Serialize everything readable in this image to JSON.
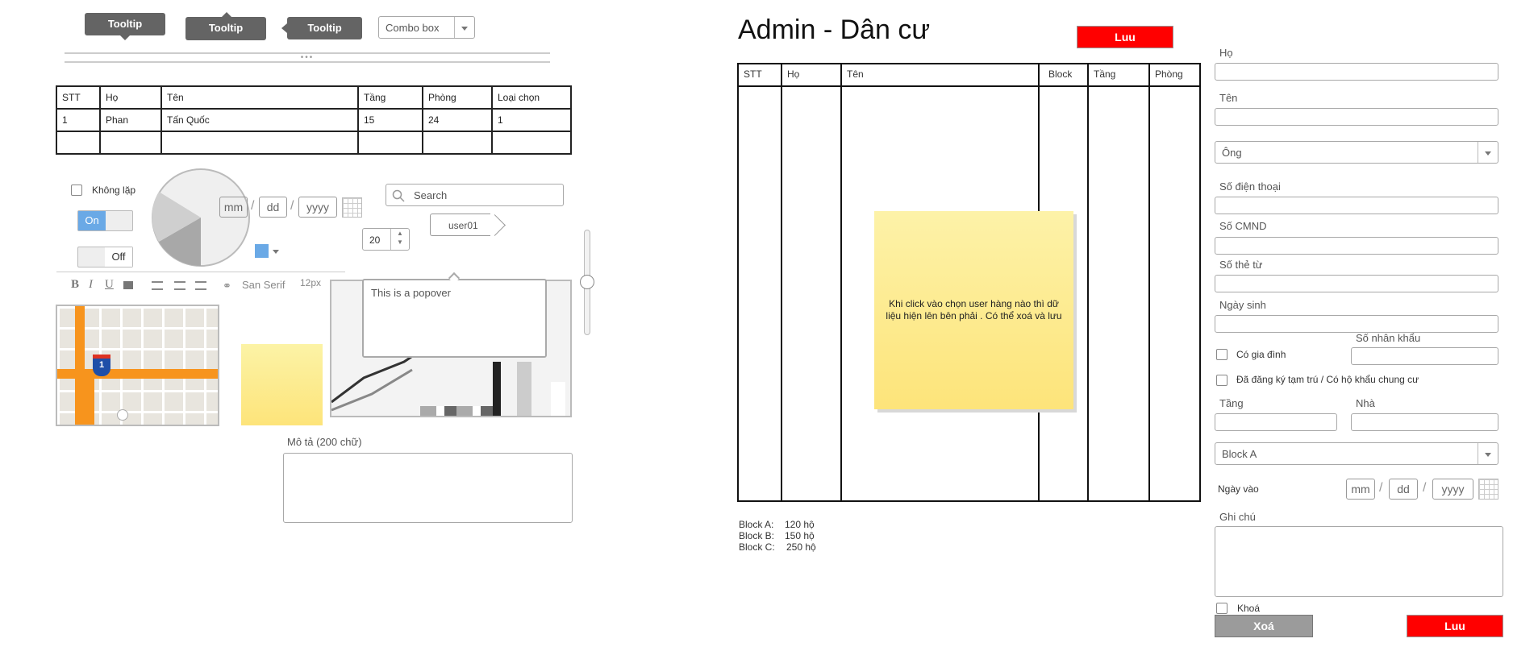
{
  "left": {
    "tooltips": [
      "Tooltip",
      "Tooltip",
      "Tooltip"
    ],
    "combo_box": "Combo box",
    "table": {
      "headers": [
        "STT",
        "Họ",
        "Tên",
        "Tầng",
        "Phòng",
        "Loại chọn"
      ],
      "rows": [
        [
          "1",
          "Phan",
          "Tấn Quốc",
          "15",
          "24",
          "1"
        ]
      ]
    },
    "checkbox_label": "Không lặp",
    "toggle_on": "On",
    "toggle_off": "Off",
    "date": {
      "mm": "mm",
      "dd": "dd",
      "yyyy": "yyyy"
    },
    "search_placeholder": "Search",
    "user_tag": "user01",
    "stepper_value": "20",
    "editor": {
      "font": "San Serif",
      "size": "12px"
    },
    "popover": "This is a popover",
    "description_label": "Mô tả (200 chữ)"
  },
  "right": {
    "title": "Admin - Dân cư",
    "save_top": "Luu",
    "table_headers": [
      "STT",
      "Họ",
      "Tên",
      "Block",
      "Tầng",
      "Phòng"
    ],
    "note": "Khi click vào chọn user hàng nào thì dữ liệu hiện lên bên phải . Có thể xoá và lưu",
    "summary": [
      {
        "label": "Block A:",
        "value": "120 hộ"
      },
      {
        "label": "Block B:",
        "value": "150 hộ"
      },
      {
        "label": "Block C:",
        "value": "250 hộ"
      }
    ],
    "form": {
      "ho": "Họ",
      "ten": "Tên",
      "honorific": "Ông",
      "phone": "Số điện thoại",
      "cmnd": "Số CMND",
      "card": "Số thẻ từ",
      "dob": "Ngày sinh",
      "family_label": "Có gia đình",
      "household_count": "Số nhân khẩu",
      "registered_label": "Đã đăng ký tạm trú / Có hộ khẩu chung cư",
      "floor": "Tầng",
      "house": "Nhà",
      "block": "Block A",
      "entry_date": "Ngày vào",
      "date": {
        "mm": "mm",
        "dd": "dd",
        "yyyy": "yyyy"
      },
      "notes": "Ghi chú",
      "lock": "Khoá",
      "delete_btn": "Xoá",
      "save_btn": "Luu"
    }
  }
}
